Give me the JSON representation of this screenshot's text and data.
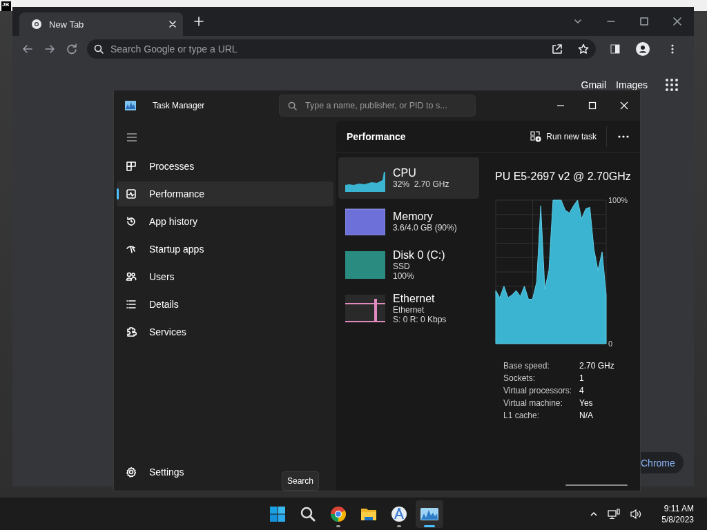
{
  "background_window": {
    "logo": "JB"
  },
  "browser": {
    "tabs": [
      {
        "label": "New Tab",
        "selected": true
      }
    ],
    "address_bar": {
      "placeholder": "Search Google or type a URL"
    },
    "links": [
      "Gmail",
      "Images"
    ],
    "chip": "Chrome"
  },
  "task_manager": {
    "title": "Task Manager",
    "search": {
      "placeholder": "Type a name, publisher, or PID to s..."
    },
    "nav": [
      {
        "label": "Processes",
        "selected": false
      },
      {
        "label": "Performance",
        "selected": true
      },
      {
        "label": "App history",
        "selected": false
      },
      {
        "label": "Startup apps",
        "selected": false
      },
      {
        "label": "Users",
        "selected": false
      },
      {
        "label": "Details",
        "selected": false
      },
      {
        "label": "Services",
        "selected": false
      }
    ],
    "settings": "Settings",
    "page_title": "Performance",
    "run_new_task": "Run new task",
    "resources": [
      {
        "kind": "cpu",
        "name": "CPU",
        "details": [
          "32%  2.70 GHz"
        ],
        "selected": true,
        "color": "#3ab4d0"
      },
      {
        "kind": "memory",
        "name": "Memory",
        "details": [
          "3.6/4.0 GB (90%)"
        ],
        "selected": false,
        "color": "#6c70d8"
      },
      {
        "kind": "disk",
        "name": "Disk 0 (C:)",
        "details": [
          "SSD",
          "100%"
        ],
        "selected": false,
        "color": "#2a8c80"
      },
      {
        "kind": "network",
        "name": "Ethernet",
        "details": [
          "Ethernet",
          "S: 0 R: 0 Kbps"
        ],
        "selected": false,
        "color": "#e08ac0"
      }
    ],
    "detail": {
      "title": "PU E5-2697 v2 @ 2.70GHz",
      "chart_data": {
        "type": "area",
        "ylim": [
          0,
          100
        ],
        "yticks": [
          {
            "value": 0,
            "label": "0"
          },
          {
            "value": 100,
            "label": "100%"
          }
        ],
        "values": [
          37,
          32,
          40,
          32,
          34,
          37,
          33,
          40,
          31,
          31,
          43,
          96,
          38,
          51,
          100,
          100,
          100,
          93,
          91,
          96,
          100,
          87,
          94,
          95,
          66,
          51,
          64,
          34
        ]
      },
      "stats": [
        {
          "label": "Base speed:",
          "value": "2.70 GHz"
        },
        {
          "label": "Sockets:",
          "value": "1"
        },
        {
          "label": "Virtual processors:",
          "value": "4"
        },
        {
          "label": "Virtual machine:",
          "value": "Yes"
        },
        {
          "label": "L1 cache:",
          "value": "N/A"
        }
      ]
    }
  },
  "taskbar": {
    "apps": [
      {
        "kind": "start",
        "running": false,
        "selected": false
      },
      {
        "kind": "search",
        "running": false,
        "selected": false,
        "tooltip": "Search"
      },
      {
        "kind": "chrome",
        "running": true,
        "selected": false
      },
      {
        "kind": "files",
        "running": false,
        "selected": false
      },
      {
        "kind": "studio",
        "running": true,
        "selected": false
      },
      {
        "kind": "taskmanager",
        "running": true,
        "selected": true
      }
    ],
    "clock": {
      "time": "9:11 AM",
      "date": "5/8/2023"
    }
  }
}
